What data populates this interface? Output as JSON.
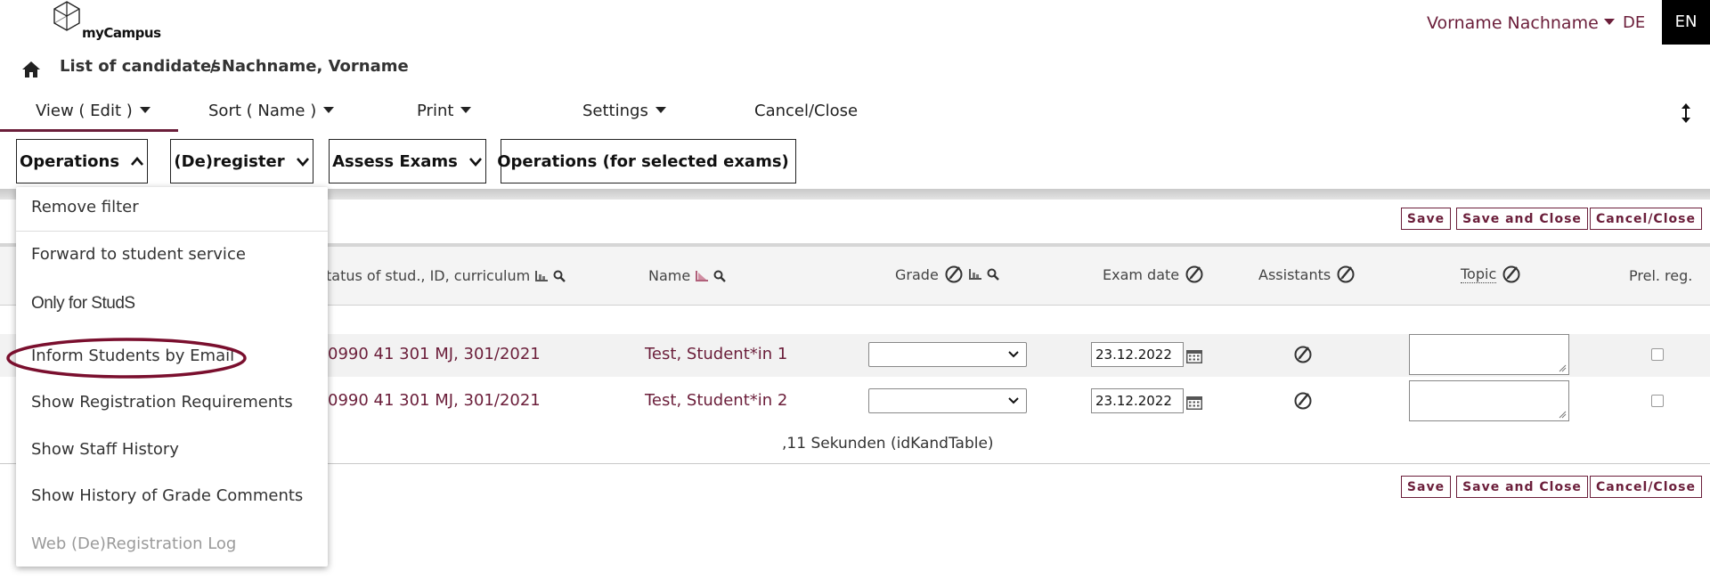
{
  "header": {
    "logo_text": "myCampus",
    "user_name": "Vorname Nachname",
    "lang_de": "DE",
    "lang_en": "EN"
  },
  "breadcrumb": {
    "list": "List of candidates",
    "current": "/ Nachname, Vorname"
  },
  "menu": {
    "view": "View ( Edit )",
    "sort": "Sort ( Name )",
    "print": "Print",
    "settings": "Settings",
    "cancel": "Cancel/Close"
  },
  "dropdowns": {
    "operations": "Operations",
    "deregister": "(De)register",
    "assess": "Assess Exams",
    "ops_selected": "Operations (for selected exams)"
  },
  "buttons": {
    "save": "Save",
    "save_close": "Save and Close",
    "cancel_close": "Cancel/Close"
  },
  "table": {
    "headers": {
      "status": "tatus of stud., ID, curriculum",
      "name": "Name",
      "grade": "Grade",
      "exam_date": "Exam date",
      "assistants": "Assistants",
      "topic": "Topic",
      "prel_reg": "Prel. reg."
    },
    "rows": [
      {
        "id": "0990 41 301 MJ, 301/2021",
        "name": "Test, Student*in 1",
        "date": "23.12.2022"
      },
      {
        "id": "0990 41 301 MJ, 301/2021",
        "name": "Test, Student*in 2",
        "date": "23.12.2022"
      }
    ],
    "footer": ",11 Sekunden (idKandTable)"
  },
  "operations_menu": {
    "items": [
      "Remove filter",
      "Forward to student service",
      "Only for StudS",
      "Inform Students by Email",
      "Show Registration Requirements",
      "Show Staff History",
      "Show History of Grade Comments",
      "Web (De)Registration Log"
    ]
  },
  "colors": {
    "accent": "#6b1e3a",
    "highlight_ellipse": "#7a0f2e"
  }
}
